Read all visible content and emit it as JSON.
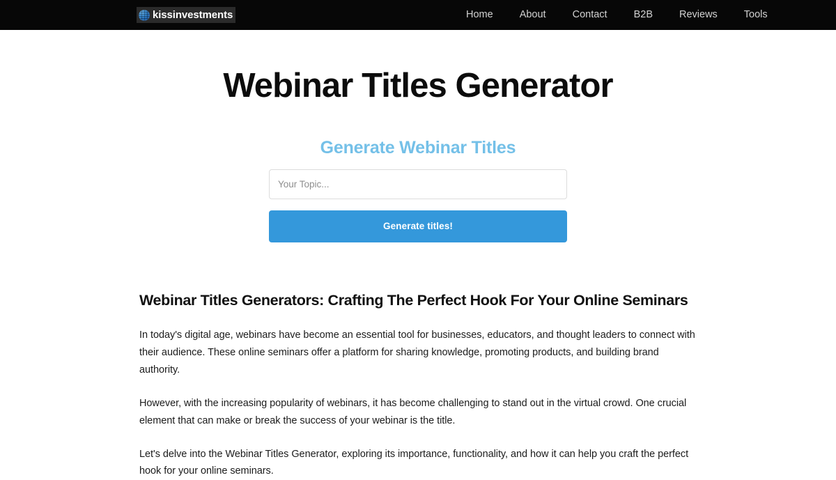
{
  "header": {
    "brand": {
      "text": "kissinvestments",
      "icon": "globe-icon"
    },
    "nav": [
      {
        "label": "Home"
      },
      {
        "label": "About"
      },
      {
        "label": "Contact"
      },
      {
        "label": "B2B"
      },
      {
        "label": "Reviews"
      },
      {
        "label": "Tools"
      }
    ],
    "background_color": "#070707",
    "link_color": "#d2d2d2"
  },
  "hero": {
    "title": "Webinar Titles Generator"
  },
  "tool": {
    "heading": "Generate Webinar Titles",
    "heading_color": "#74c0e8",
    "input": {
      "placeholder": "Your Topic...",
      "value": ""
    },
    "submit_label": "Generate titles!",
    "submit_color": "#3498db"
  },
  "article": {
    "heading": "Webinar Titles Generators: Crafting The Perfect Hook For Your Online Seminars",
    "paragraphs": [
      "In today's digital age, webinars have become an essential tool for businesses, educators, and thought leaders to connect with their audience. These online seminars offer a platform for sharing knowledge, promoting products, and building brand authority.",
      "However, with the increasing popularity of webinars, it has become challenging to stand out in the virtual crowd. One crucial element that can make or break the success of your webinar is the title.",
      "Let's delve into the Webinar Titles Generator, exploring its importance, functionality, and how it can help you craft the perfect hook for your online seminars."
    ]
  }
}
